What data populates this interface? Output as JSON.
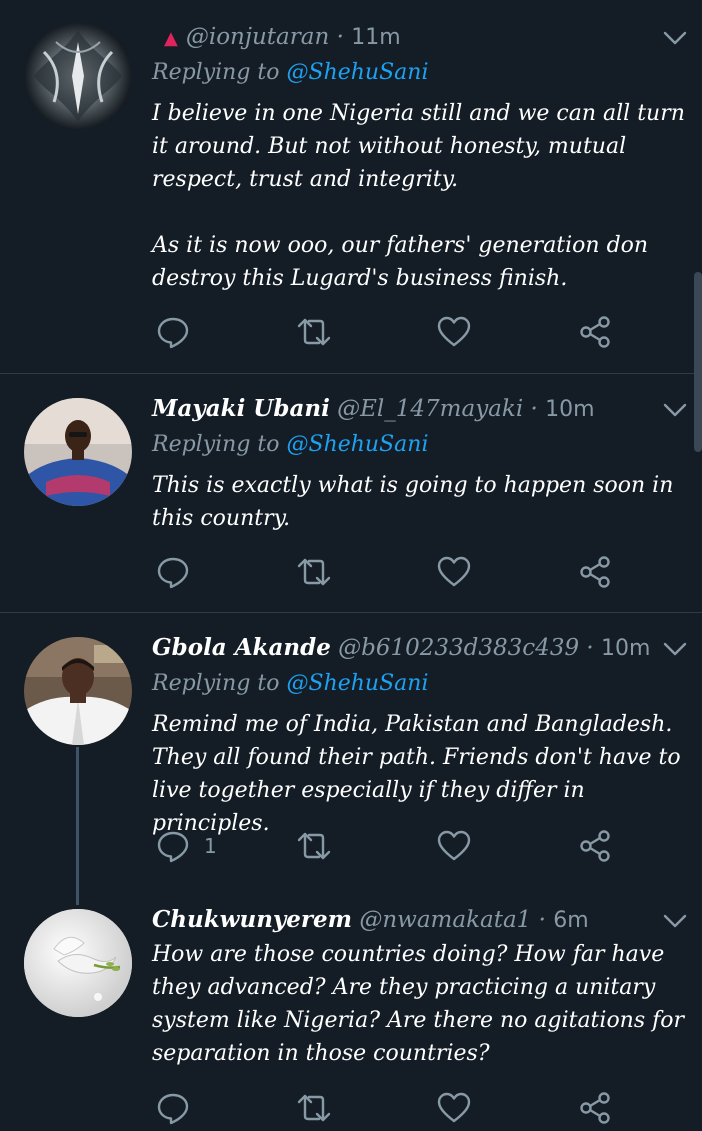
{
  "colors": {
    "background": "#141d26",
    "text": "#ffffff",
    "muted": "#8899a6",
    "link": "#1da1f2",
    "warning": "#e0245e"
  },
  "tweets": [
    {
      "name": "",
      "handle": "@ionjutaran",
      "time": "11m",
      "replying_label": "Replying to",
      "replying_to": "@ShehuSani",
      "text": "I believe in one Nigeria still and we can all turn it around. But not without honesty, mutual respect, trust and integrity.\n\nAs it is now ooo, our fathers' generation don destroy this Lugard's business finish.",
      "replies": "",
      "icons": [
        "warning-icon",
        "reply-icon",
        "retweet-icon",
        "like-icon",
        "share-icon",
        "chevron-down-icon"
      ]
    },
    {
      "name": "Mayaki Ubani",
      "handle": "@El_147mayaki",
      "time": "10m",
      "replying_label": "Replying to",
      "replying_to": "@ShehuSani",
      "text": "This is exactly what is going to happen soon in this country.",
      "replies": ""
    },
    {
      "name": "Gbola Akande",
      "handle": "@b610233d383c439",
      "time": "10m",
      "replying_label": "Replying to",
      "replying_to": "@ShehuSani",
      "text": "Remind me of India, Pakistan and Bangladesh. They all found their path. Friends don't have to live together especially if they differ in principles.",
      "replies": "1"
    },
    {
      "name": "Chukwunyerem",
      "handle": "@nwamakata1",
      "time": "6m",
      "text": "How are those countries doing? How far have they advanced? Are they practicing a unitary system like Nigeria? Are there no agitations for separation in those countries?",
      "replies": ""
    }
  ],
  "separator": "·"
}
